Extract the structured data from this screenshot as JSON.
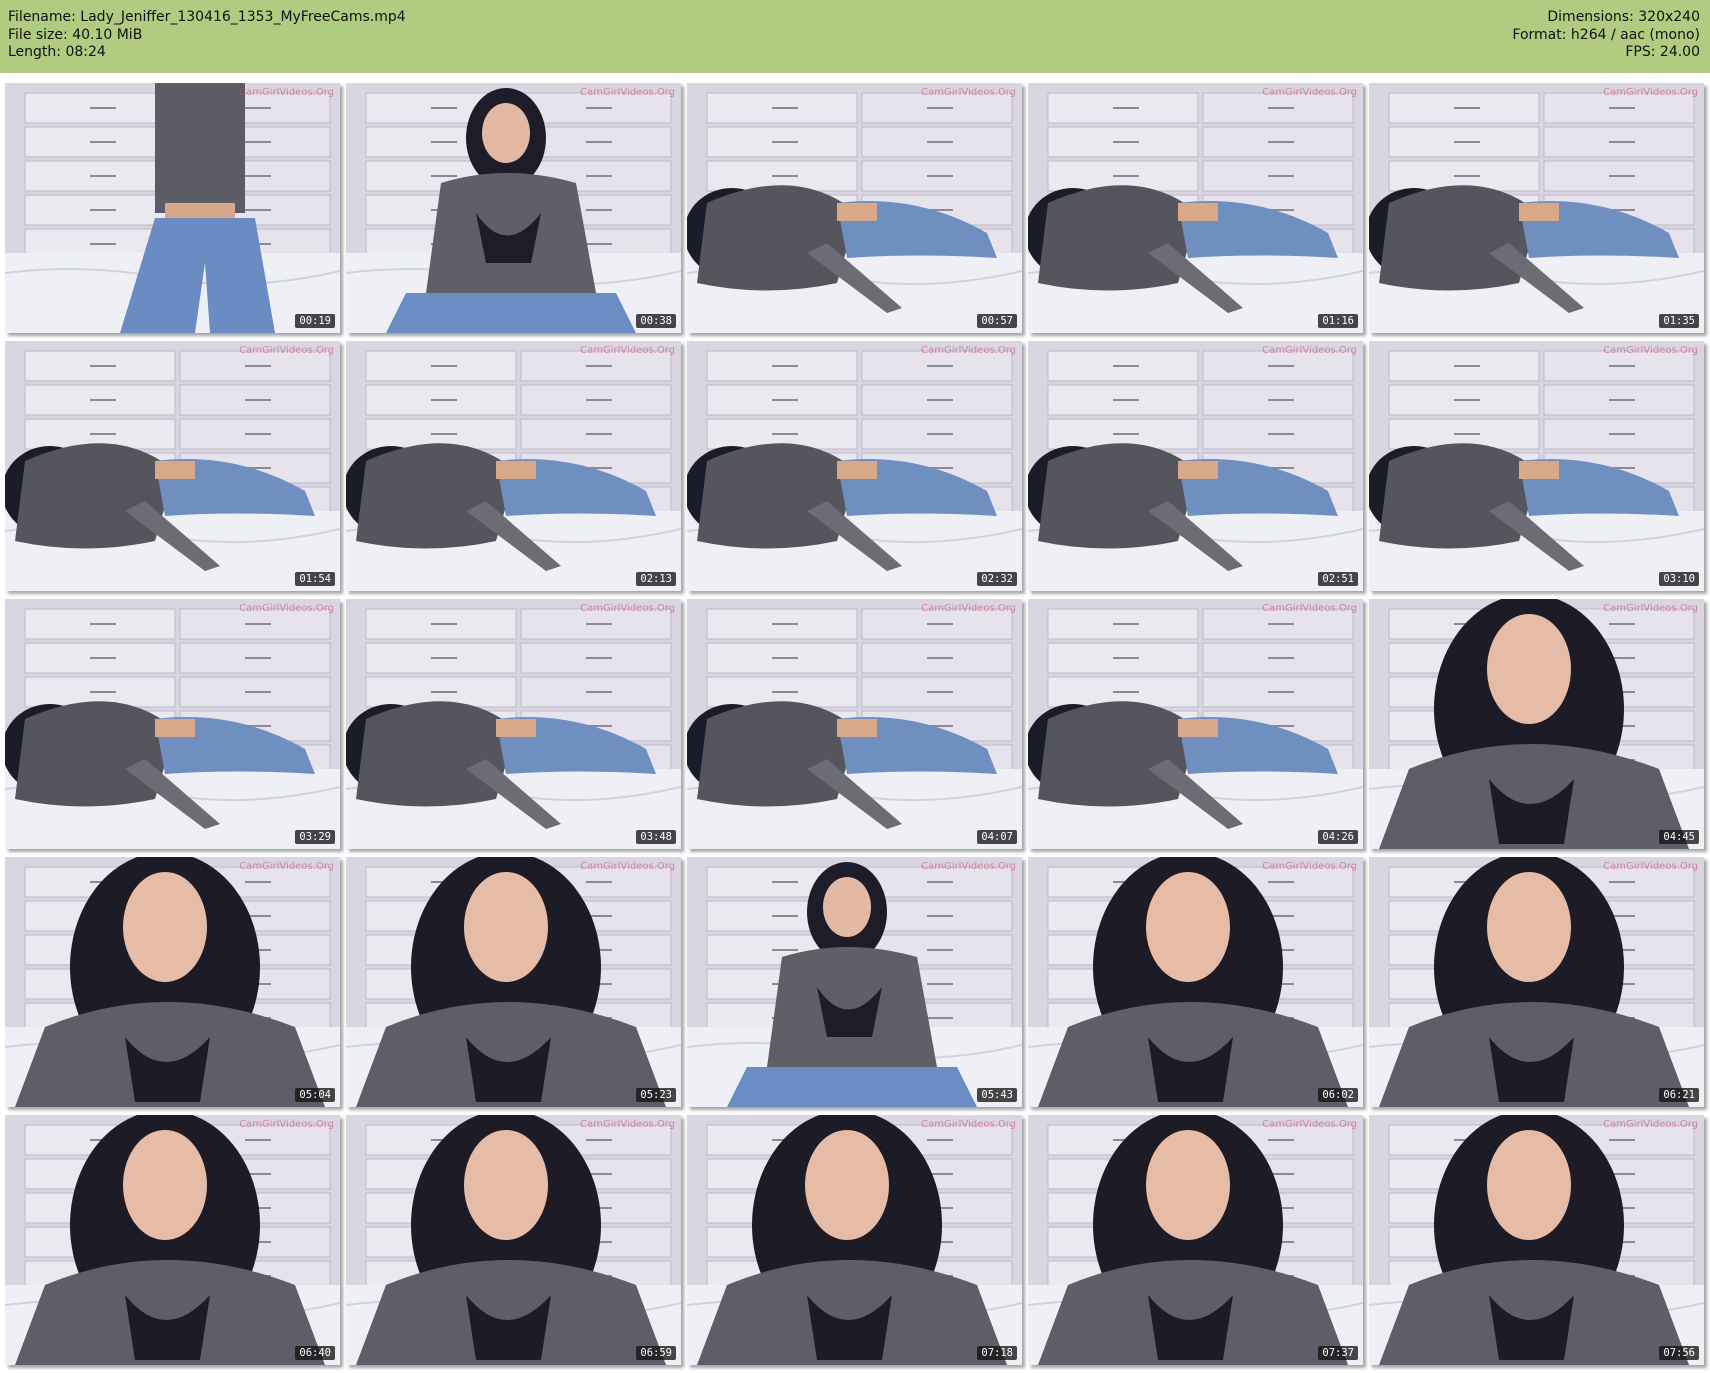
{
  "header": {
    "filename": "Filename: Lady_Jeniffer_130416_1353_MyFreeCams.mp4",
    "filesize": "File size: 40.10 MiB",
    "length": "Length: 08:24",
    "dimensions": "Dimensions: 320x240",
    "format": "Format: h264 / aac (mono)",
    "fps": "FPS: 24.00"
  },
  "colors": {
    "header_bg": "#b0cc80",
    "timestamp_bg": "#1a1a1a"
  },
  "thumbnails": [
    {
      "time": "00:19",
      "watermark": "CamGirlVideos.Org",
      "scene": "standing"
    },
    {
      "time": "00:38",
      "watermark": "CamGirlVideos.Org",
      "scene": "kneeling"
    },
    {
      "time": "00:57",
      "watermark": "CamGirlVideos.Org",
      "scene": "lying"
    },
    {
      "time": "01:16",
      "watermark": "CamGirlVideos.Org",
      "scene": "lying"
    },
    {
      "time": "01:35",
      "watermark": "CamGirlVideos.Org",
      "scene": "lying"
    },
    {
      "time": "01:54",
      "watermark": "CamGirlVideos.Org",
      "scene": "lying"
    },
    {
      "time": "02:13",
      "watermark": "CamGirlVideos.Org",
      "scene": "lying"
    },
    {
      "time": "02:32",
      "watermark": "CamGirlVideos.Org",
      "scene": "lying"
    },
    {
      "time": "02:51",
      "watermark": "CamGirlVideos.Org",
      "scene": "lying"
    },
    {
      "time": "03:10",
      "watermark": "CamGirlVideos.Org",
      "scene": "lying"
    },
    {
      "time": "03:29",
      "watermark": "CamGirlVideos.Org",
      "scene": "lying"
    },
    {
      "time": "03:48",
      "watermark": "CamGirlVideos.Org",
      "scene": "lying"
    },
    {
      "time": "04:07",
      "watermark": "CamGirlVideos.Org",
      "scene": "lying"
    },
    {
      "time": "04:26",
      "watermark": "CamGirlVideos.Org",
      "scene": "lying"
    },
    {
      "time": "04:45",
      "watermark": "CamGirlVideos.Org",
      "scene": "closeup"
    },
    {
      "time": "05:04",
      "watermark": "CamGirlVideos.Org",
      "scene": "closeup"
    },
    {
      "time": "05:23",
      "watermark": "CamGirlVideos.Org",
      "scene": "closeup"
    },
    {
      "time": "05:43",
      "watermark": "CamGirlVideos.Org",
      "scene": "kneeling"
    },
    {
      "time": "06:02",
      "watermark": "CamGirlVideos.Org",
      "scene": "closeup"
    },
    {
      "time": "06:21",
      "watermark": "CamGirlVideos.Org",
      "scene": "closeup"
    },
    {
      "time": "06:40",
      "watermark": "CamGirlVideos.Org",
      "scene": "closeup"
    },
    {
      "time": "06:59",
      "watermark": "CamGirlVideos.Org",
      "scene": "closeup"
    },
    {
      "time": "07:18",
      "watermark": "CamGirlVideos.Org",
      "scene": "closeup"
    },
    {
      "time": "07:37",
      "watermark": "CamGirlVideos.Org",
      "scene": "closeup"
    },
    {
      "time": "07:56",
      "watermark": "CamGirlVideos.Org",
      "scene": "closeup"
    }
  ]
}
